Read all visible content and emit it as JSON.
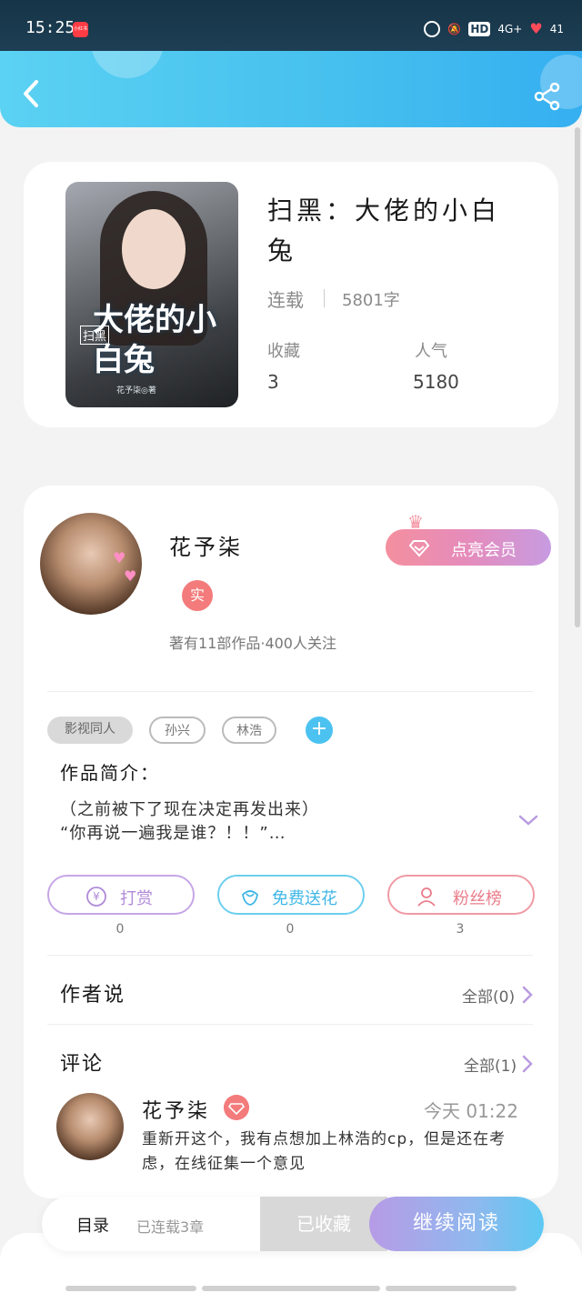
{
  "status_bar": {
    "time": "15:25",
    "app_icon_text": "小红书",
    "network": "4G+",
    "hd": "HD",
    "battery": "41"
  },
  "book": {
    "title": "扫黑：大佬的小白兔",
    "status": "连载",
    "word_count": "5801字",
    "collect_label": "收藏",
    "collect_value": "3",
    "popularity_label": "人气",
    "popularity_value": "5180",
    "cover": {
      "tag": "扫黑",
      "title": "大佬的小白兔",
      "author": "花予柒◎著"
    }
  },
  "author": {
    "name": "花予柒",
    "badge": "实",
    "stats": "著有11部作品·400人关注",
    "vip_button": "点亮会员"
  },
  "tags": [
    "影视同人",
    "孙兴",
    "林浩"
  ],
  "intro": {
    "title": "作品简介：",
    "line1": "（之前被下了现在决定再发出来）",
    "line2": "“你再说一遍我是谁？！！”…"
  },
  "actions": [
    {
      "label": "打赏",
      "count": "0"
    },
    {
      "label": "免费送花",
      "count": "0"
    },
    {
      "label": "粉丝榜",
      "count": "3"
    }
  ],
  "author_says": {
    "title": "作者说",
    "link": "全部(0)"
  },
  "comments": {
    "title": "评论",
    "link": "全部(1)",
    "items": [
      {
        "name": "花予柒",
        "time": "今天 01:22",
        "text": "重新开这个，我有点想加上林浩的cp，但是还在考虑，在线征集一个意见"
      }
    ]
  },
  "bottom_bar": {
    "toc": "目录",
    "toc_status": "已连载3章",
    "collected": "已收藏",
    "continue": "继续阅读"
  },
  "colors": {
    "header_start": "#5bd2f3",
    "header_end": "#35aff0",
    "accent_pink": "#f48f9e",
    "accent_purple": "#b79be6",
    "accent_blue": "#4cc2f0"
  }
}
